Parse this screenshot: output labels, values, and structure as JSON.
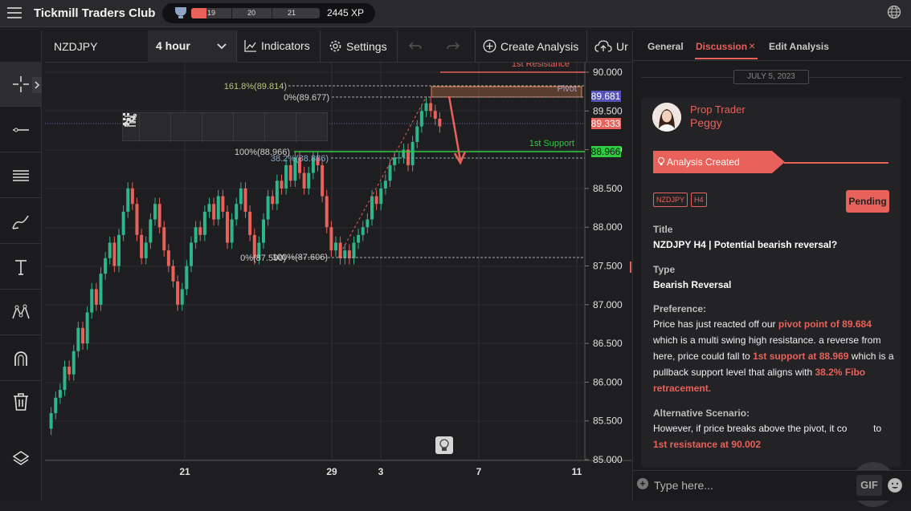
{
  "app": {
    "title": "Tickmill Traders Club",
    "xp": {
      "levels": [
        "19",
        "20",
        "21"
      ],
      "total": "2445 XP",
      "progress": 0.12
    }
  },
  "chart_header": {
    "symbol": "NZDJPY",
    "timeframe": "4 hour",
    "indicators_label": "Indicators",
    "settings_label": "Settings",
    "create_analysis_label": "Create Analysis",
    "upload_label": "Ur"
  },
  "tools": [
    "crosshair-icon",
    "horizontal-line-icon",
    "fibonacci-icon",
    "brush-icon",
    "text-icon",
    "pattern-icon",
    "magnet-icon",
    "trash-icon",
    "layers-icon"
  ],
  "chart": {
    "price_ticks": [
      "90.000",
      "89.500",
      "89.000",
      "88.500",
      "88.000",
      "87.500",
      "87.000",
      "86.500",
      "86.000",
      "85.500",
      "85.000"
    ],
    "date_ticks": [
      "21",
      "29",
      "3",
      "7",
      "11"
    ],
    "price_labels": {
      "high": "89.681",
      "current": "89.333",
      "support": "88.966"
    },
    "annotations": {
      "resistance": "1st Resistance",
      "pivot": "Pivot",
      "support": "1st Support",
      "fib_ext": "161.8%(89.814)",
      "fib_0_top": "0%(89.677)",
      "fib_100_mid": "100%(88.966)",
      "fib_382": "38.2%(88.886)",
      "fib_0_bottom": "0%(87.590)",
      "fib_100_bottom": "100%(87.606)"
    }
  },
  "panel": {
    "tabs": {
      "general": "General",
      "discussion": "Discussion",
      "close": "×",
      "edit": "Edit Analysis"
    },
    "date": "JULY 5, 2023",
    "author_role": "Prop Trader",
    "author_name": "Peggy",
    "banner": "Analysis Created",
    "tags": [
      "NZDJPY",
      "H4"
    ],
    "status": "Pending",
    "title_label": "Title",
    "title_value": "NZDJPY H4 | Potential bearish reversal?",
    "type_label": "Type",
    "type_value": "Bearish Reversal",
    "preference_label": "Preference:",
    "pref": {
      "t1": "Price has just reacted off our ",
      "h1": "pivot point of 89.684",
      "t2": " which is a multi swing high resistance. a reverse from here, price could fall to ",
      "h2": "1st support at 88.969",
      "t3": " which is a pullback support level that aligns with ",
      "h3": "38.2% Fibo retracement."
    },
    "alt_label": "Alternative Scenario:",
    "alt": {
      "t1": "However, if price breaks above the pivot, it co",
      "t1b": "to",
      "h1": "1st resistance at 90.002"
    },
    "compose_placeholder": "Type here...",
    "gif_label": "GIF"
  },
  "colors": {
    "accent": "#e8615a",
    "bull": "#2fb58a",
    "bear": "#e8615a",
    "support": "#2ecc40"
  }
}
